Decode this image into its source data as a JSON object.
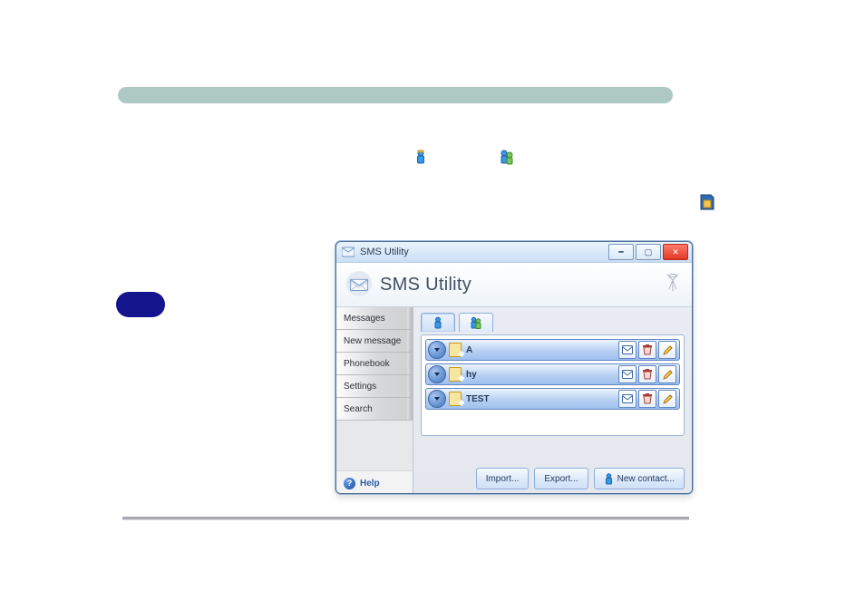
{
  "window": {
    "title": "SMS Utility",
    "app_name": "SMS Utility"
  },
  "sidebar": {
    "items": [
      {
        "label": "Messages"
      },
      {
        "label": "New message"
      },
      {
        "label": "Phonebook"
      },
      {
        "label": "Settings"
      },
      {
        "label": "Search"
      }
    ],
    "help_label": "Help"
  },
  "tabs": {
    "single_icon": "single-person-icon",
    "group_icon": "group-person-icon"
  },
  "contacts": [
    {
      "name": "A"
    },
    {
      "name": "hy"
    },
    {
      "name": "TEST"
    }
  ],
  "buttons": {
    "import": "Import...",
    "export": "Export...",
    "new_contact": "New contact..."
  }
}
